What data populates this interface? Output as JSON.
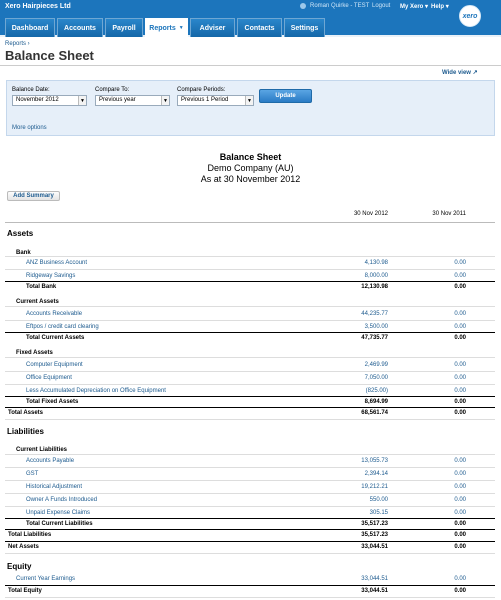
{
  "topbar": {
    "org_name": "Xero Hairpieces Ltd",
    "user_name": "Roman Quirke - TEST",
    "logout": "Logout",
    "my_xero": "My Xero",
    "help": "Help",
    "logo_text": "xero"
  },
  "nav": {
    "tabs": [
      {
        "label": "Dashboard"
      },
      {
        "label": "Accounts"
      },
      {
        "label": "Payroll"
      },
      {
        "label": "Reports",
        "dropdown": true,
        "active": true
      },
      {
        "label": "Adviser"
      },
      {
        "label": "Contacts"
      },
      {
        "label": "Settings"
      }
    ]
  },
  "header": {
    "breadcrumb": "Reports ›",
    "title": "Balance Sheet",
    "wide_view": "Wide view ↗"
  },
  "filters": {
    "balance_date_label": "Balance Date:",
    "balance_date_value": "November 2012",
    "compare_to_label": "Compare To:",
    "compare_to_value": "Previous year",
    "compare_periods_label": "Compare Periods:",
    "compare_periods_value": "Previous 1 Period",
    "update_button": "Update",
    "more_options": "More options"
  },
  "report": {
    "title": "Balance Sheet",
    "company": "Demo Company (AU)",
    "as_at": "As at 30 November 2012",
    "add_summary": "Add Summary",
    "col1": "30 Nov 2012",
    "col2": "30 Nov 2011"
  },
  "rows": {
    "assets": "Assets",
    "bank": "Bank",
    "anz": {
      "label": "ANZ Business Account",
      "v1": "4,130.98",
      "v2": "0.00"
    },
    "ridgeway": {
      "label": "Ridgeway Savings",
      "v1": "8,000.00",
      "v2": "0.00"
    },
    "total_bank": {
      "label": "Total Bank",
      "v1": "12,130.98",
      "v2": "0.00"
    },
    "current_assets": "Current Assets",
    "ar": {
      "label": "Accounts Receivable",
      "v1": "44,235.77",
      "v2": "0.00"
    },
    "eftpos": {
      "label": "Eftpos / credit card clearing",
      "v1": "3,500.00",
      "v2": "0.00"
    },
    "total_current_assets": {
      "label": "Total Current Assets",
      "v1": "47,735.77",
      "v2": "0.00"
    },
    "fixed_assets": "Fixed Assets",
    "computer": {
      "label": "Computer Equipment",
      "v1": "2,469.99",
      "v2": "0.00"
    },
    "office": {
      "label": "Office Equipment",
      "v1": "7,050.00",
      "v2": "0.00"
    },
    "depreciation": {
      "label": "Less Accumulated Depreciation on Office Equipment",
      "v1": "(825.00)",
      "v2": "0.00"
    },
    "total_fixed_assets": {
      "label": "Total Fixed Assets",
      "v1": "8,694.99",
      "v2": "0.00"
    },
    "total_assets": {
      "label": "Total Assets",
      "v1": "68,561.74",
      "v2": "0.00"
    },
    "liabilities": "Liabilities",
    "current_liabilities": "Current Liabilities",
    "ap": {
      "label": "Accounts Payable",
      "v1": "13,055.73",
      "v2": "0.00"
    },
    "gst": {
      "label": "GST",
      "v1": "2,394.14",
      "v2": "0.00"
    },
    "historical": {
      "label": "Historical Adjustment",
      "v1": "19,212.21",
      "v2": "0.00"
    },
    "owner_funds": {
      "label": "Owner A Funds Introduced",
      "v1": "550.00",
      "v2": "0.00"
    },
    "unpaid": {
      "label": "Unpaid Expense Claims",
      "v1": "305.15",
      "v2": "0.00"
    },
    "total_current_liabilities": {
      "label": "Total Current Liabilities",
      "v1": "35,517.23",
      "v2": "0.00"
    },
    "total_liabilities": {
      "label": "Total Liabilities",
      "v1": "35,517.23",
      "v2": "0.00"
    },
    "net_assets": {
      "label": "Net Assets",
      "v1": "33,044.51",
      "v2": "0.00"
    },
    "equity": "Equity",
    "current_year_earnings": {
      "label": "Current Year Earnings",
      "v1": "33,044.51",
      "v2": "0.00"
    },
    "total_equity": {
      "label": "Total Equity",
      "v1": "33,044.51",
      "v2": "0.00"
    }
  }
}
